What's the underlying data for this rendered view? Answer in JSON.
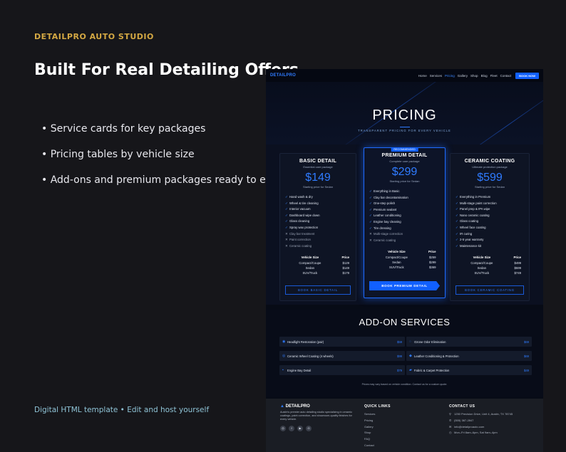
{
  "promo": {
    "brand": "DETAILPRO AUTO STUDIO",
    "title": "Built For Real Detailing Offers",
    "bullets": [
      "• Service cards for key packages",
      "• Pricing tables by vehicle size",
      "• Add-ons and premium packages ready to edit"
    ],
    "footer": "Digital HTML template • Edit and host yourself"
  },
  "colors": {
    "accent": "#1160ff",
    "brand_gold": "#d4a843",
    "bg": "#16161a"
  },
  "nav": {
    "logo": "DETAILPRO",
    "links": [
      "Home",
      "Services",
      "Pricing",
      "Gallery",
      "Shop",
      "Blog",
      "Fleet",
      "Contact"
    ],
    "active": "Pricing",
    "cta": "BOOK NOW"
  },
  "hero": {
    "title": "PRICING",
    "subtitle": "TRANSPARENT PRICING FOR EVERY VEHICLE"
  },
  "plans": [
    {
      "name": "BASIC DETAIL",
      "desc": "Essential care package",
      "price": "$149",
      "note": "Starting price for Sedan",
      "features": [
        {
          "t": "Hand wash & dry",
          "on": true
        },
        {
          "t": "Wheel & tire cleaning",
          "on": true
        },
        {
          "t": "Interior vacuum",
          "on": true
        },
        {
          "t": "Dashboard wipe down",
          "on": true
        },
        {
          "t": "Glass cleaning",
          "on": true
        },
        {
          "t": "Spray wax protection",
          "on": true
        },
        {
          "t": "Clay bar treatment",
          "on": false
        },
        {
          "t": "Paint correction",
          "on": false
        },
        {
          "t": "Ceramic coating",
          "on": false
        }
      ],
      "table_head": [
        "Vehicle Size",
        "Price"
      ],
      "rows": [
        [
          "Compact/Coupe",
          "$129"
        ],
        [
          "Sedan",
          "$149"
        ],
        [
          "SUV/Truck",
          "$179"
        ]
      ],
      "button": "BOOK BASIC DETAIL"
    },
    {
      "name": "PREMIUM DETAIL",
      "badge": "RECOMMENDED",
      "desc": "Complete care package",
      "price": "$299",
      "note": "Starting price for Sedan",
      "features": [
        {
          "t": "Everything in Basic",
          "on": true
        },
        {
          "t": "Clay bar decontamination",
          "on": true
        },
        {
          "t": "One-step polish",
          "on": true
        },
        {
          "t": "Premium sealant",
          "on": true
        },
        {
          "t": "Leather conditioning",
          "on": true
        },
        {
          "t": "Engine bay cleaning",
          "on": true
        },
        {
          "t": "Tire dressing",
          "on": true
        },
        {
          "t": "Multi-stage correction",
          "on": false
        },
        {
          "t": "Ceramic coating",
          "on": false
        }
      ],
      "table_head": [
        "Vehicle Size",
        "Price"
      ],
      "rows": [
        [
          "Compact/Coupe",
          "$259"
        ],
        [
          "Sedan",
          "$299"
        ],
        [
          "SUV/Truck",
          "$369"
        ]
      ],
      "button": "BOOK PREMIUM DETAIL"
    },
    {
      "name": "CERAMIC COATING",
      "desc": "Ultimate protection package",
      "price": "$599",
      "note": "Starting price for Sedan",
      "features": [
        {
          "t": "Everything in Premium",
          "on": true
        },
        {
          "t": "Multi-stage paint correction",
          "on": true
        },
        {
          "t": "Panel prep & IPA wipe",
          "on": true
        },
        {
          "t": "Nano ceramic coating",
          "on": true
        },
        {
          "t": "Glass coating",
          "on": true
        },
        {
          "t": "Wheel face coating",
          "on": true
        },
        {
          "t": "IR curing",
          "on": true
        },
        {
          "t": "2-5 year warranty",
          "on": true
        },
        {
          "t": "Maintenance kit",
          "on": true
        }
      ],
      "table_head": [
        "Vehicle Size",
        "Price"
      ],
      "rows": [
        [
          "Compact/Coupe",
          "$499"
        ],
        [
          "Sedan",
          "$599"
        ],
        [
          "SUV/Truck",
          "$749"
        ]
      ],
      "button": "BOOK CERAMIC COATING"
    }
  ],
  "addons": {
    "title": "ADD-ON SERVICES",
    "items": [
      {
        "name": "Headlight Restoration (pair)",
        "price": "$59",
        "icon": "lightbulb-icon"
      },
      {
        "name": "Ozone Odor Elimination",
        "price": "$69",
        "icon": "wind-icon"
      },
      {
        "name": "Ceramic Wheel Coating (4 wheels)",
        "price": "$99",
        "icon": "wheel-icon"
      },
      {
        "name": "Leather Conditioning & Protection",
        "price": "$69",
        "icon": "leather-icon"
      },
      {
        "name": "Engine Bay Detail",
        "price": "$79",
        "icon": "engine-icon"
      },
      {
        "name": "Fabric & Carpet Protection",
        "price": "$49",
        "icon": "carpet-icon"
      }
    ],
    "note": "Prices may vary based on vehicle condition. Contact us for a custom quote."
  },
  "footer": {
    "logo": "DETAILPRO",
    "desc": "Austin's premier auto detailing studio specializing in ceramic coatings, paint correction, and showroom-quality finishes for every vehicle.",
    "socials": [
      "◎",
      "f",
      "▶",
      "G"
    ],
    "quick_head": "QUICK LINKS",
    "quick": [
      "Services",
      "Pricing",
      "Gallery",
      "Shop",
      "FAQ",
      "Contact"
    ],
    "contact_head": "CONTACT US",
    "contact": [
      "1250 Precision Drive, Unit 4, Austin, TX 78745",
      "(555) 387-2847",
      "info@detailproauto.com",
      "Mon–Fri 8am–6pm, Sat 9am–4pm"
    ]
  }
}
